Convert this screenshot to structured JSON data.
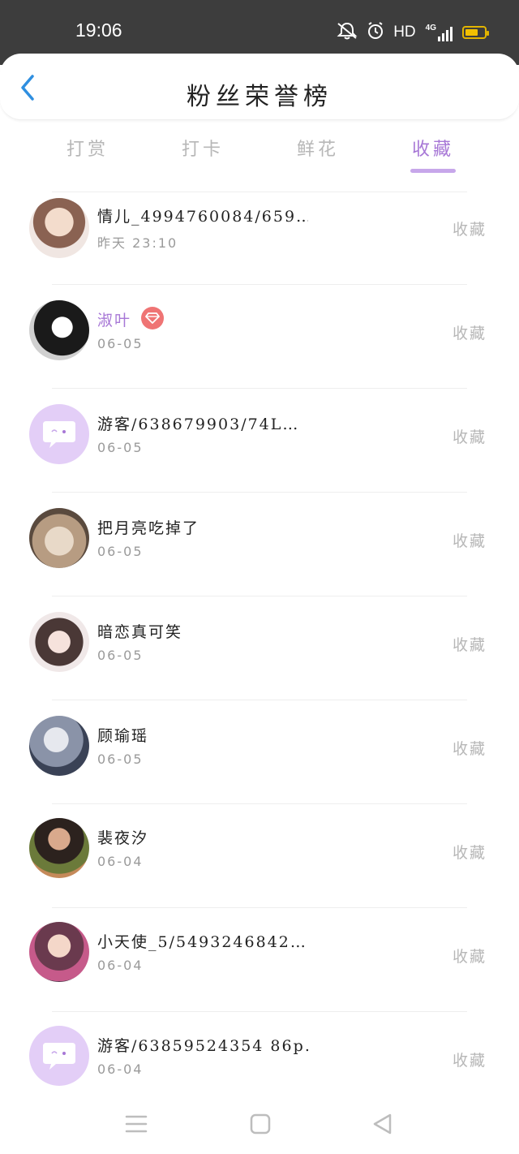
{
  "status_bar": {
    "time": "19:06",
    "hd_label": "HD",
    "network_label": "4G",
    "icons": [
      "bell-muted-icon",
      "alarm-icon",
      "signal-icon",
      "battery-icon"
    ],
    "battery_level": 0.7
  },
  "header": {
    "title": "粉丝荣誉榜",
    "back_icon": "chevron-left-icon"
  },
  "tabs": [
    {
      "label": "打赏",
      "active": false
    },
    {
      "label": "打卡",
      "active": false
    },
    {
      "label": "鲜花",
      "active": false
    },
    {
      "label": "收藏",
      "active": true
    }
  ],
  "list": [
    {
      "name": "情儿_4994760084/659…",
      "date": "昨天 23:10",
      "action": "收藏",
      "avatar": "anime-girl-avatar",
      "vip": false
    },
    {
      "name": "淑叶",
      "date": "06-05",
      "action": "收藏",
      "avatar": "manga-girl-avatar",
      "vip": true,
      "badge": "diamond-badge-icon"
    },
    {
      "name": "游客/638679903/74L…",
      "date": "06-05",
      "action": "收藏",
      "avatar": "default-chat-avatar",
      "vip": false
    },
    {
      "name": "把月亮吃掉了",
      "date": "06-05",
      "action": "收藏",
      "avatar": "cat-avatar",
      "vip": false
    },
    {
      "name": "暗恋真可笑",
      "date": "06-05",
      "action": "收藏",
      "avatar": "anime-girl-avatar",
      "vip": false
    },
    {
      "name": "顾瑜瑶",
      "date": "06-05",
      "action": "收藏",
      "avatar": "photo-avatar",
      "vip": false
    },
    {
      "name": "裴夜汐",
      "date": "06-04",
      "action": "收藏",
      "avatar": "photo-avatar",
      "vip": false
    },
    {
      "name": "小天使_5/5493246842…",
      "date": "06-04",
      "action": "收藏",
      "avatar": "costume-girl-avatar",
      "vip": false
    },
    {
      "name": "游客/63859524354 86p…",
      "date": "06-04",
      "action": "收藏",
      "avatar": "default-chat-avatar",
      "vip": false
    }
  ],
  "nav_bar": {
    "items": [
      "menu-icon",
      "home-square-icon",
      "back-triangle-icon"
    ]
  },
  "colors": {
    "accent": "#a777d6",
    "status_bar": "#3d3d3d",
    "back_icon": "#2f8fe0",
    "badge": "#ef7474",
    "default_avatar": "#e3cef7"
  }
}
